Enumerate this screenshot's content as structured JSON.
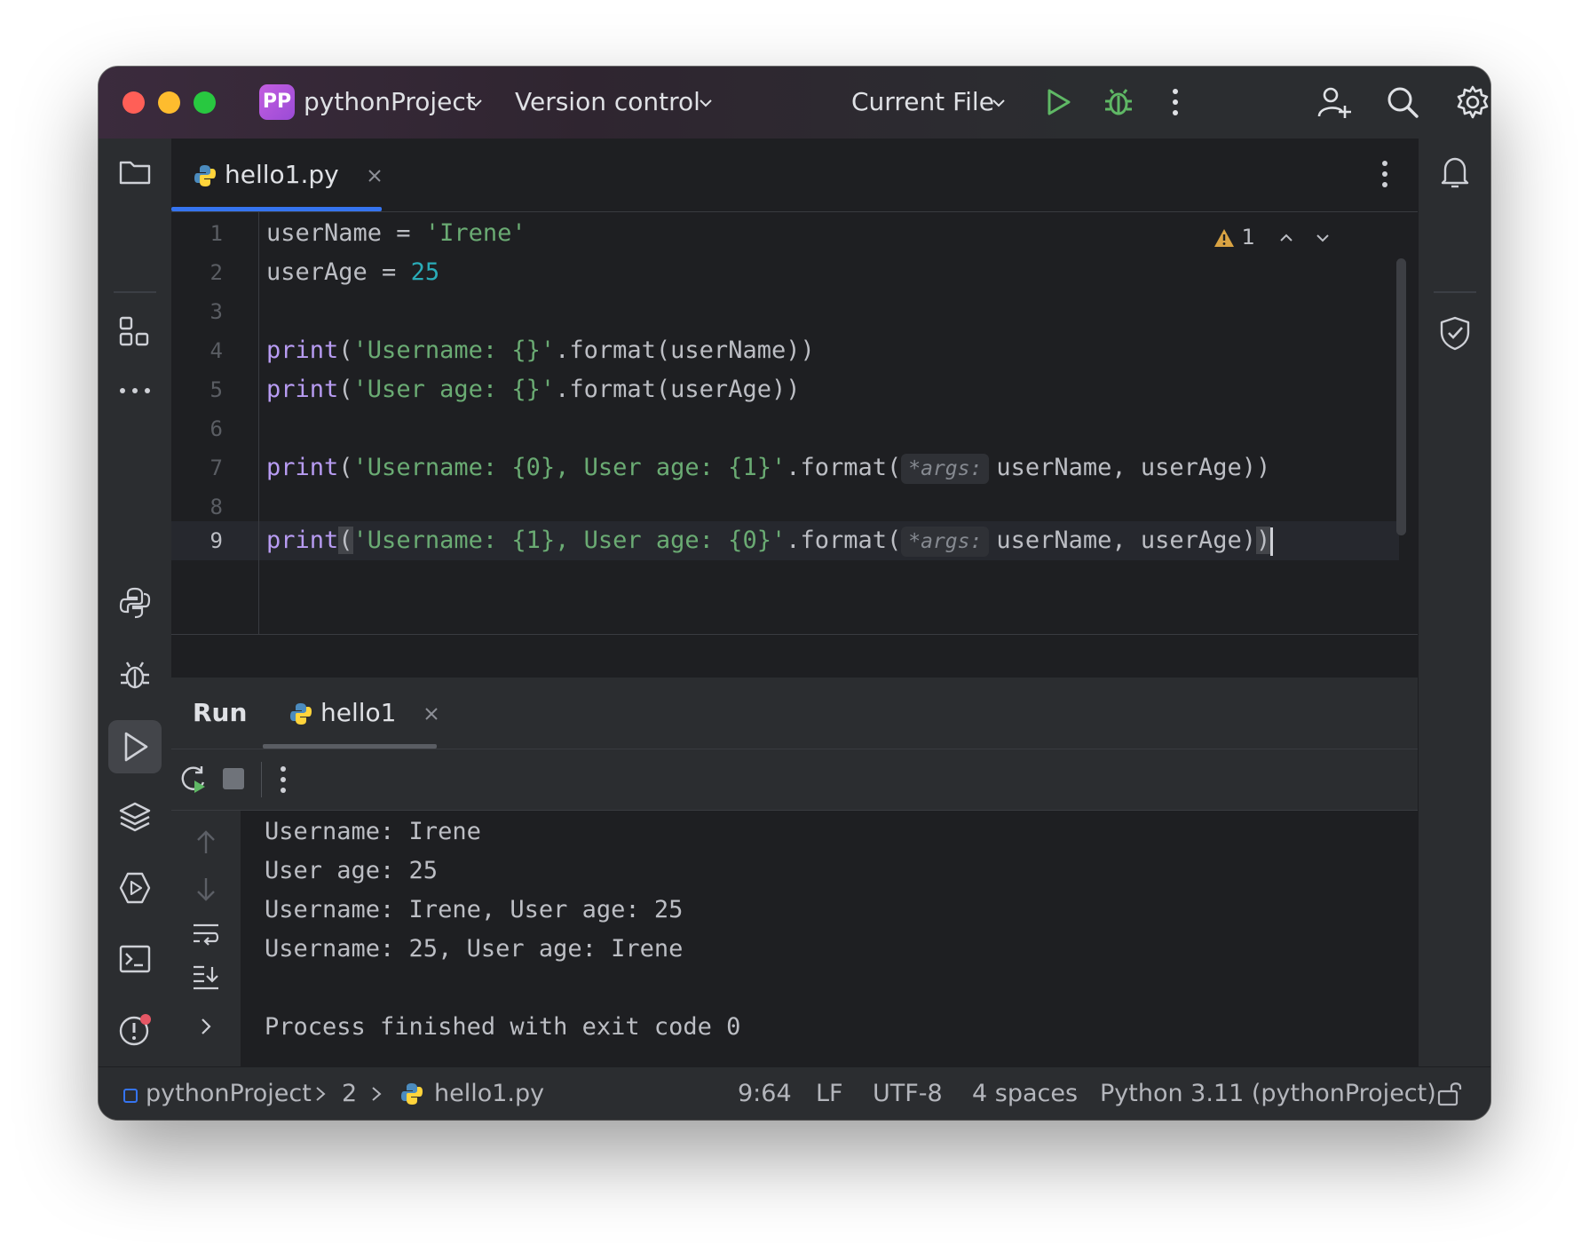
{
  "titlebar": {
    "project_badge": "PP",
    "project_name": "pythonProject",
    "version_control": "Version control",
    "run_config": "Current File"
  },
  "editor": {
    "tab_name": "hello1.py",
    "warning_count": "1",
    "line_numbers": [
      "1",
      "2",
      "3",
      "4",
      "5",
      "6",
      "7",
      "8",
      "9"
    ],
    "current_line": 9,
    "lines": [
      {
        "var": "userName",
        "op": " = ",
        "str": "'Irene'"
      },
      {
        "var": "userAge",
        "op": " = ",
        "num": "25"
      },
      {},
      {
        "kw": "print",
        "open": "(",
        "str": "'Username: {}'",
        "rest": ".format(userName))"
      },
      {
        "kw": "print",
        "open": "(",
        "str": "'User age: {}'",
        "rest": ".format(userAge))"
      },
      {},
      {
        "kw": "print",
        "open": "(",
        "str": "'Username: {0}, User age: {1}'",
        "mid": ".format(",
        "hint": "*args:",
        "rest": "userName, userAge))"
      },
      {},
      {
        "kw": "print",
        "open": "(",
        "str": "'Username: {1}, User age: {0}'",
        "mid": ".format(",
        "hint": "*args:",
        "rest": "userName, userAge)",
        "close": ")"
      }
    ]
  },
  "run_panel": {
    "title": "Run",
    "tab": "hello1",
    "output": [
      "Username: Irene",
      "User age: 25",
      "Username: Irene, User age: 25",
      "Username: 25, User age: Irene",
      "",
      "Process finished with exit code 0"
    ]
  },
  "statusbar": {
    "project": "pythonProject",
    "crumb": "2",
    "file": "hello1.py",
    "position": "9:64",
    "line_sep": "LF",
    "encoding": "UTF-8",
    "indent": "4 spaces",
    "interpreter": "Python 3.11 (pythonProject)"
  },
  "colors": {
    "accent": "#3574f0",
    "keyword": "#b89cf3",
    "string": "#6aab73",
    "number": "#2aacb8",
    "run_green": "#5fb865"
  },
  "icons": [
    "folder-icon",
    "structure-icon",
    "more-icon",
    "python-console-icon",
    "debug-icon",
    "run-icon",
    "layers-icon",
    "services-icon",
    "terminal-icon",
    "problems-icon",
    "git-icon",
    "notifications-icon",
    "shield-check-icon",
    "add-user-icon",
    "search-icon",
    "gear-icon",
    "rerun-icon",
    "stop-icon",
    "scroll-up-icon",
    "scroll-down-icon",
    "soft-wrap-icon",
    "scroll-to-end-icon",
    "expand-icon",
    "lock-icon",
    "python-file-icon",
    "warning-icon"
  ]
}
